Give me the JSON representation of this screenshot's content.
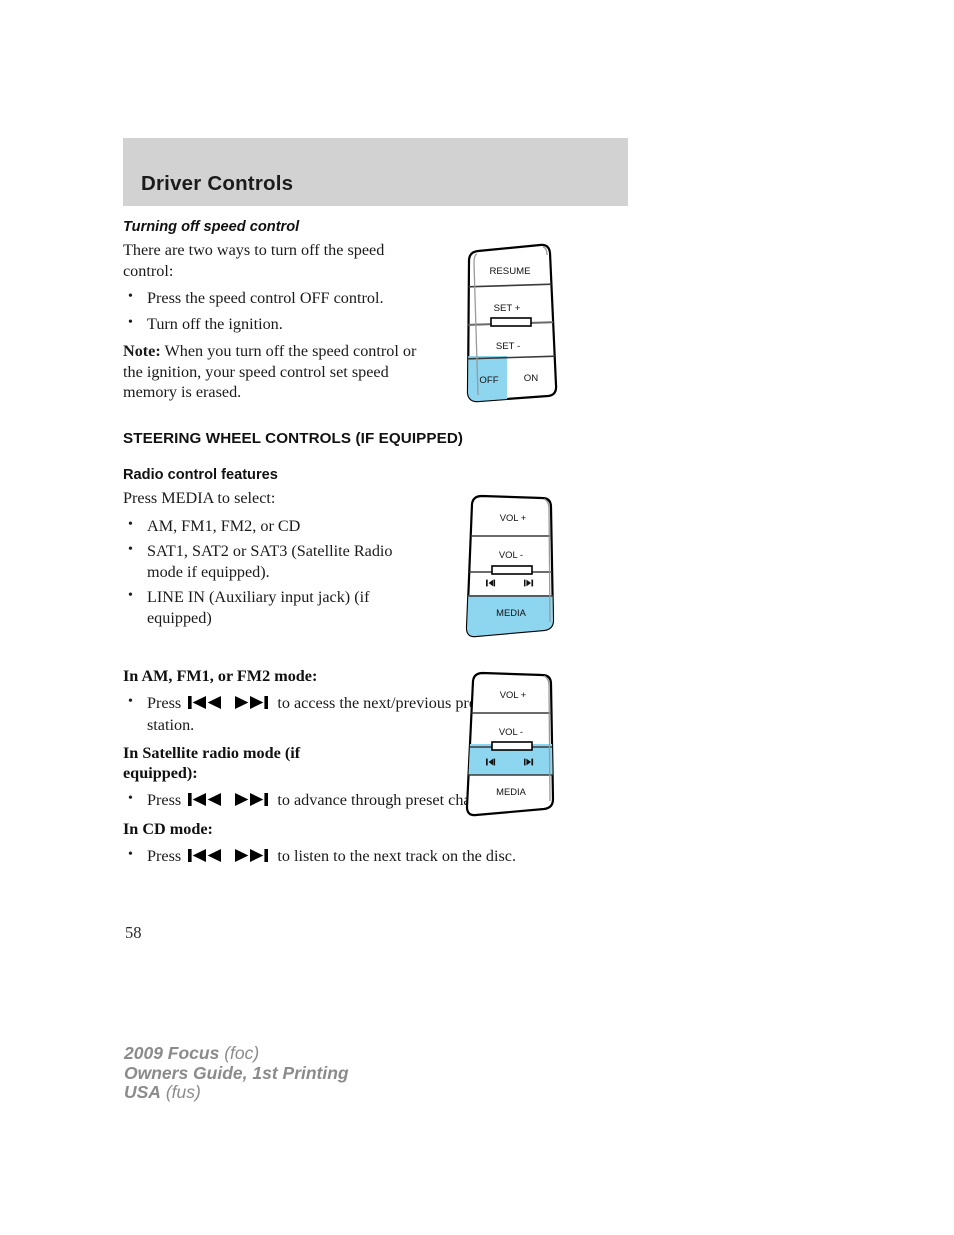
{
  "header": {
    "title": "Driver Controls",
    "band_color": "#d2d2d2"
  },
  "colors": {
    "highlight_blue": "#8ed5ef",
    "panel_outline": "#000000",
    "divider": "#5a5a5a"
  },
  "sections": [
    {
      "heading": "Turning off speed control",
      "intro": "There are two ways to turn off the speed control:",
      "bullets": [
        "Press the speed control OFF control.",
        "Turn off the ignition."
      ],
      "note_label": "Note:",
      "note_text": " When you turn off the speed control or the ignition, your speed control set speed memory is erased."
    },
    {
      "heading": "STEERING WHEEL CONTROLS (IF EQUIPPED)",
      "subheading": "Radio control features",
      "intro": "Press MEDIA to select:",
      "bullets": [
        "AM, FM1, FM2, or CD",
        "SAT1, SAT2 or SAT3 (Satellite Radio mode if equipped).",
        "LINE IN (Auxiliary input jack) (if equipped)"
      ]
    }
  ],
  "modes": [
    {
      "heading": "In AM, FM1, or FM2 mode:",
      "press_label": "Press",
      "after_text": "to access the next/previous preset station."
    },
    {
      "heading": "In Satellite radio mode (if equipped):",
      "press_label": "Press",
      "after_text": "to advance through preset channels."
    },
    {
      "heading": "In CD mode:",
      "press_label": "Press",
      "after_text": "to listen to the next track on the disc."
    }
  ],
  "diagrams": {
    "speed_control": {
      "name": "speed-control-switch",
      "rows": [
        {
          "label": "RESUME",
          "highlighted": false
        },
        {
          "label": "SET  +",
          "highlighted": false
        },
        {
          "label": "SET  -",
          "highlighted": false
        }
      ],
      "bottom_left": {
        "label": "OFF",
        "highlighted": true
      },
      "bottom_right": {
        "label": "ON",
        "highlighted": false
      }
    },
    "steering_media": {
      "name": "steering-wheel-media-switch",
      "rows": [
        {
          "label": "VOL  +",
          "highlighted": false
        },
        {
          "label": "VOL  -",
          "highlighted": false
        },
        {
          "label": "seek-row",
          "highlighted": false
        },
        {
          "label": "MEDIA",
          "highlighted": true
        }
      ],
      "seek_back_icon": "seek-previous-icon",
      "seek_fwd_icon": "seek-next-icon"
    },
    "steering_seek": {
      "name": "steering-wheel-seek-switch",
      "rows": [
        {
          "label": "VOL  +",
          "highlighted": false
        },
        {
          "label": "VOL  -",
          "highlighted": false
        },
        {
          "label": "seek-row",
          "highlighted": true
        },
        {
          "label": "MEDIA",
          "highlighted": false
        }
      ],
      "seek_back_icon": "seek-previous-icon",
      "seek_fwd_icon": "seek-next-icon"
    }
  },
  "footer": {
    "page_number": "58",
    "line1_bold": "2009 Focus",
    "line1_rest": " (foc)",
    "line2_bold": "Owners Guide, 1st Printing",
    "line3_bold": "USA",
    "line3_rest": " (fus)"
  }
}
